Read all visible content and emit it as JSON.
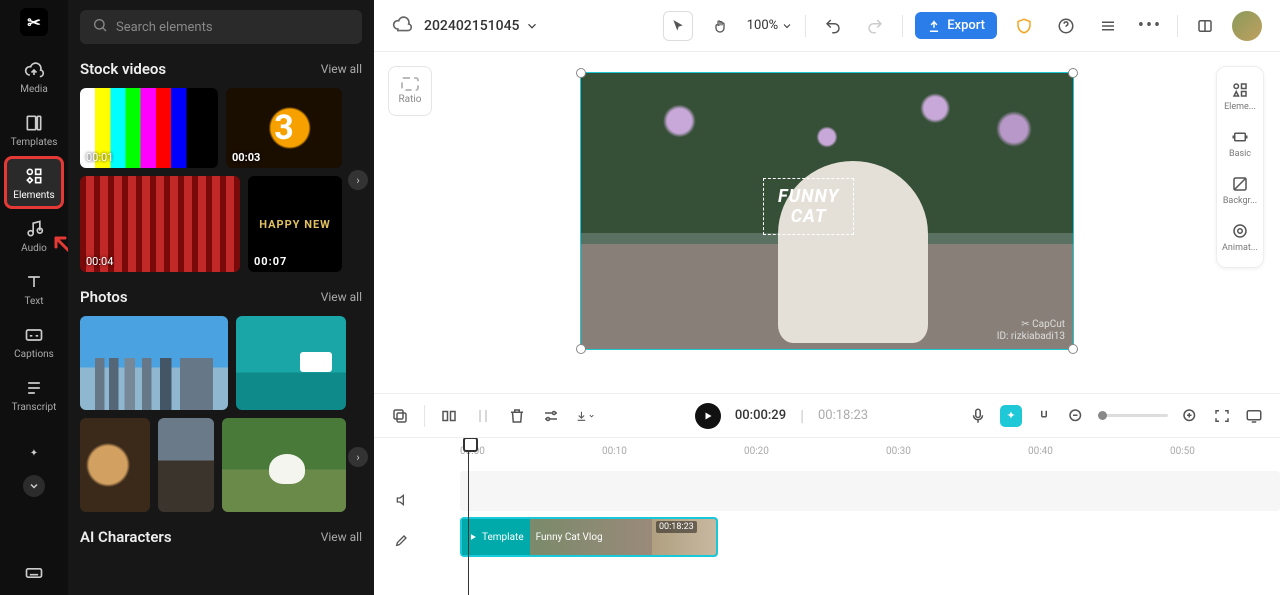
{
  "nav": {
    "items": [
      {
        "label": "Media"
      },
      {
        "label": "Templates"
      },
      {
        "label": "Elements"
      },
      {
        "label": "Audio"
      },
      {
        "label": "Text"
      },
      {
        "label": "Captions"
      },
      {
        "label": "Transcript"
      }
    ]
  },
  "search": {
    "placeholder": "Search elements"
  },
  "sections": {
    "stock_videos": {
      "title": "Stock videos",
      "view_all": "View all",
      "items": [
        {
          "duration": "00:01"
        },
        {
          "duration": "00:03",
          "glyph": "3"
        },
        {
          "duration": "00:04"
        },
        {
          "duration": "00:07",
          "glyph": "HAPPY NEW"
        }
      ]
    },
    "photos": {
      "title": "Photos",
      "view_all": "View all"
    },
    "ai_characters": {
      "title": "AI Characters",
      "view_all": "View all"
    }
  },
  "header": {
    "project_name": "202402151045",
    "zoom": "100%",
    "export_label": "Export"
  },
  "ratio_button": {
    "label": "Ratio"
  },
  "right_tools": [
    {
      "label": "Eleme..."
    },
    {
      "label": "Basic"
    },
    {
      "label": "Backgr..."
    },
    {
      "label": "Animat..."
    }
  ],
  "preview": {
    "caption_line1": "FUNNY",
    "caption_line2": "CAT",
    "watermark_brand": "✂ CapCut",
    "watermark_id": "ID: rizkiabadi13"
  },
  "playback": {
    "current": "00:00:29",
    "total": "00:18:23"
  },
  "ruler": {
    "marks": [
      "00:00",
      "00:10",
      "00:20",
      "00:30",
      "00:40",
      "00:50"
    ]
  },
  "clip": {
    "template_badge": "Template",
    "name": "Funny Cat Vlog",
    "duration": "00:18:23"
  }
}
